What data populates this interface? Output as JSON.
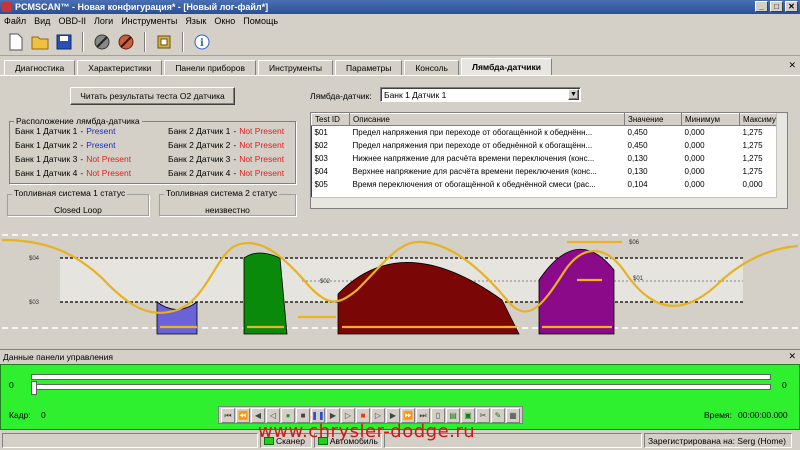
{
  "window": {
    "title": "PCMSCAN™ - Новая конфигурация* - [Новый лог-файл*]",
    "minimize": "_",
    "maximize": "□",
    "close": "✕"
  },
  "menu": [
    "Файл",
    "Вид",
    "OBD-II",
    "Логи",
    "Инструменты",
    "Язык",
    "Окно",
    "Помощь"
  ],
  "toolbar": {
    "icons": [
      "new-file-icon",
      "open-folder-icon",
      "save-icon",
      "connect-icon",
      "disconnect-icon",
      "settings-frame-icon",
      "info-icon"
    ]
  },
  "tabs": {
    "items": [
      "Диагностика",
      "Характеристики",
      "Панели приборов",
      "Инструменты",
      "Параметры",
      "Консоль",
      "Лямбда-датчики"
    ],
    "active_index": 6,
    "close": "✕"
  },
  "lambda": {
    "read_button": "Читать результаты теста O2 датчика",
    "sensor_label": "Лямбда-датчик:",
    "sensor_selected": "Банк 1 Датчик 1",
    "layout_title": "Расположение лямбда-датчика",
    "sensors": [
      {
        "name": "Банк 1 Датчик 1",
        "status": "Present",
        "present": true
      },
      {
        "name": "Банк 1 Датчик 2",
        "status": "Present",
        "present": true
      },
      {
        "name": "Банк 1 Датчик 3",
        "status": "Not Present",
        "present": false
      },
      {
        "name": "Банк 1 Датчик 4",
        "status": "Not Present",
        "present": false
      },
      {
        "name": "Банк 2 Датчик 1",
        "status": "Not Present",
        "present": false
      },
      {
        "name": "Банк 2 Датчик 2",
        "status": "Not Present",
        "present": false
      },
      {
        "name": "Банк 2 Датчик 3",
        "status": "Not Present",
        "present": false
      },
      {
        "name": "Банк 2 Датчик 4",
        "status": "Not Present",
        "present": false
      }
    ],
    "separator": "-",
    "fuel1": {
      "title": "Топливная система 1 статус",
      "value": "Closed Loop"
    },
    "fuel2": {
      "title": "Топливная система 2 статус",
      "value": "неизвестно"
    }
  },
  "test_table": {
    "columns": [
      "Test ID",
      "Описание",
      "Значение",
      "Минимум",
      "Максиму"
    ],
    "rows": [
      [
        "$01",
        "Предел напряжения при переходе от обогащённой к обеднённ...",
        "0,450",
        "0,000",
        "1,275"
      ],
      [
        "$02",
        "Предел напряжения при переходе от обеднённой к обогащённ...",
        "0,450",
        "0,000",
        "1,275"
      ],
      [
        "$03",
        "Нижнее напряжение для расчёта времени переключения (конс...",
        "0,130",
        "0,000",
        "1,275"
      ],
      [
        "$04",
        "Верхнее напряжение для расчёта времени переключения (конс...",
        "0,130",
        "0,000",
        "1,275"
      ],
      [
        "$05",
        "Время переключения от обогащённой к обеднённой смеси (рас...",
        "0,104",
        "0,000",
        "0,000"
      ]
    ]
  },
  "waveform": {
    "label_left_top": "$04",
    "label_left_bottom": "$03",
    "label_mid": "$02",
    "label_right_top": "$06",
    "label_right_mid": "$01",
    "colors": {
      "blue": "#6a63d8",
      "green": "#0a8a0a",
      "darkred": "#7a0606",
      "purple": "#8a0a8a",
      "curve": "#e6b222",
      "line": "#000000"
    }
  },
  "dashboard": {
    "header": "Данные панели управления",
    "close": "✕",
    "slider_left": "0",
    "slider_right": "0",
    "frame_label": "Кадр:",
    "frame_value": "0",
    "time_label": "Время:",
    "time_value": "00:00:00.000",
    "controls": [
      "first-icon",
      "prev-fast-icon",
      "prev-icon",
      "step-back-icon",
      "record-icon",
      "stop-icon",
      "pause-icon",
      "play-icon",
      "play-frame-icon",
      "stop-red-icon",
      "step-forward-icon",
      "next-icon",
      "next-fast-icon",
      "last-icon",
      "new-log-icon",
      "save-log-icon",
      "export-icon",
      "cut-icon",
      "tool-icon",
      "grid-icon"
    ]
  },
  "statusbar": {
    "scanner": "Сканер",
    "vehicle": "Автомобиль",
    "registered": "Зарегистрирована на: Serg (Home)"
  },
  "watermark": "www.chrysler-dodge.ru"
}
